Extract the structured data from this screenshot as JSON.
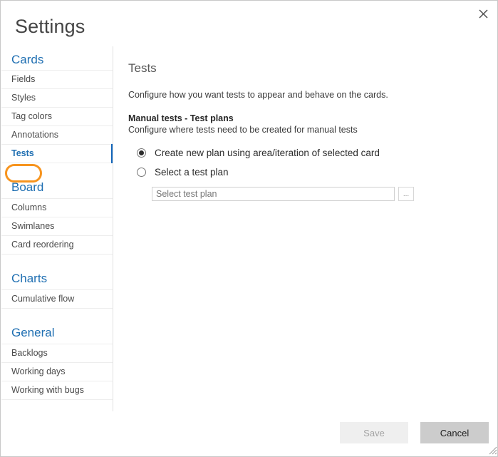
{
  "window": {
    "title": "Settings",
    "close_icon": "close-icon"
  },
  "sidebar": {
    "groups": [
      {
        "header": "Cards",
        "items": [
          {
            "label": "Fields",
            "selected": false
          },
          {
            "label": "Styles",
            "selected": false
          },
          {
            "label": "Tag colors",
            "selected": false
          },
          {
            "label": "Annotations",
            "selected": false
          },
          {
            "label": "Tests",
            "selected": true
          }
        ]
      },
      {
        "header": "Board",
        "items": [
          {
            "label": "Columns",
            "selected": false
          },
          {
            "label": "Swimlanes",
            "selected": false
          },
          {
            "label": "Card reordering",
            "selected": false
          }
        ]
      },
      {
        "header": "Charts",
        "items": [
          {
            "label": "Cumulative flow",
            "selected": false
          }
        ]
      },
      {
        "header": "General",
        "items": [
          {
            "label": "Backlogs",
            "selected": false
          },
          {
            "label": "Working days",
            "selected": false
          },
          {
            "label": "Working with bugs",
            "selected": false
          }
        ]
      }
    ]
  },
  "main": {
    "panel_title": "Tests",
    "panel_description": "Configure how you want tests to appear and behave on the cards.",
    "section_title": "Manual tests - Test plans",
    "section_description": "Configure where tests need to be created for manual tests",
    "radios": [
      {
        "label": "Create new plan using area/iteration of selected card",
        "checked": true
      },
      {
        "label": "Select a test plan",
        "checked": false
      }
    ],
    "plan_input": {
      "value": "",
      "placeholder": "Select test plan"
    },
    "browse_label": "..."
  },
  "footer": {
    "save_label": "Save",
    "cancel_label": "Cancel",
    "save_disabled": true
  },
  "colors": {
    "accent_blue": "#1f6fb2",
    "selection_bar": "#1265ba",
    "focus_ring_orange": "#f7941e",
    "cancel_button": "#cccccc",
    "save_button_disabled": "#efefef"
  }
}
